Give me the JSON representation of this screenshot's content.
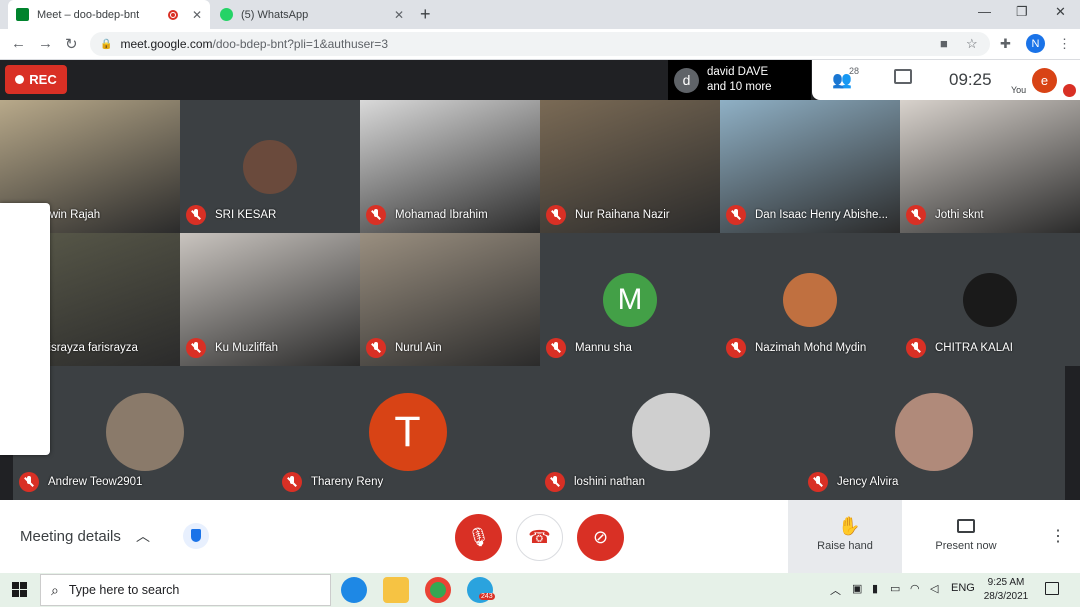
{
  "browser": {
    "tabs": [
      {
        "title": "Meet – doo-bdep-bnt",
        "active": true,
        "icon": "meet-icon",
        "recording": true
      },
      {
        "title": "(5) WhatsApp",
        "active": false,
        "icon": "whatsapp-icon"
      }
    ],
    "new_tab": "+",
    "url_host": "meet.google.com",
    "url_path": "/doo-bdep-bnt?pli=1&authuser=3",
    "profile_initial": "N"
  },
  "meet": {
    "rec_label": "REC",
    "speaker_initial": "d",
    "speaker_name": "david DAVE",
    "speaker_more": "and 10 more",
    "people_count": "28",
    "clock": "09:25",
    "self_initial": "e",
    "self_label": "You",
    "participants_row1": [
      {
        "name": "Nawin Rajah",
        "kind": "video",
        "color": "#b8a98a"
      },
      {
        "name": "SRI KESAR",
        "kind": "avatar",
        "color": "#6a4a3c"
      },
      {
        "name": "Mohamad Ibrahim",
        "kind": "video",
        "color": "#d9d9d9"
      },
      {
        "name": "Nur Raihana Nazir",
        "kind": "video",
        "color": "#7a6a55"
      },
      {
        "name": "Dan Isaac Henry Abishe...",
        "kind": "video",
        "color": "#8fb0c5"
      },
      {
        "name": "Jothi sknt",
        "kind": "video",
        "color": "#d8d2cc"
      }
    ],
    "participants_row2": [
      {
        "name": "farisrayza farisrayza",
        "kind": "video",
        "color": "#5a5a4a"
      },
      {
        "name": "Ku Muzliffah",
        "kind": "video",
        "color": "#c9c4bf"
      },
      {
        "name": "Nurul Ain",
        "kind": "video",
        "color": "#9a8f80"
      },
      {
        "name": "Mannu sha",
        "kind": "letter",
        "letter": "M",
        "color": "#43a047"
      },
      {
        "name": "Nazimah Mohd Mydin",
        "kind": "avatar",
        "color": "#c07040"
      },
      {
        "name": "CHITRA KALAI",
        "kind": "avatar",
        "color": "#1a1a1a"
      }
    ],
    "participants_row3": [
      {
        "name": "Andrew Teow2901",
        "kind": "avatar",
        "color": "#8a7a6a"
      },
      {
        "name": "Thareny Reny",
        "kind": "letter",
        "letter": "T",
        "color": "#d84315"
      },
      {
        "name": "loshini nathan",
        "kind": "avatar",
        "color": "#cfcfcf"
      },
      {
        "name": "Jency Alvira",
        "kind": "avatar",
        "color": "#b08a7a"
      }
    ],
    "meeting_details": "Meeting details",
    "raise_hand": "Raise hand",
    "present_now": "Present now"
  },
  "taskbar": {
    "search_placeholder": "Type here to search",
    "lang": "ENG",
    "time": "9:25 AM",
    "date": "28/3/2021",
    "telegram_badge": "243"
  }
}
